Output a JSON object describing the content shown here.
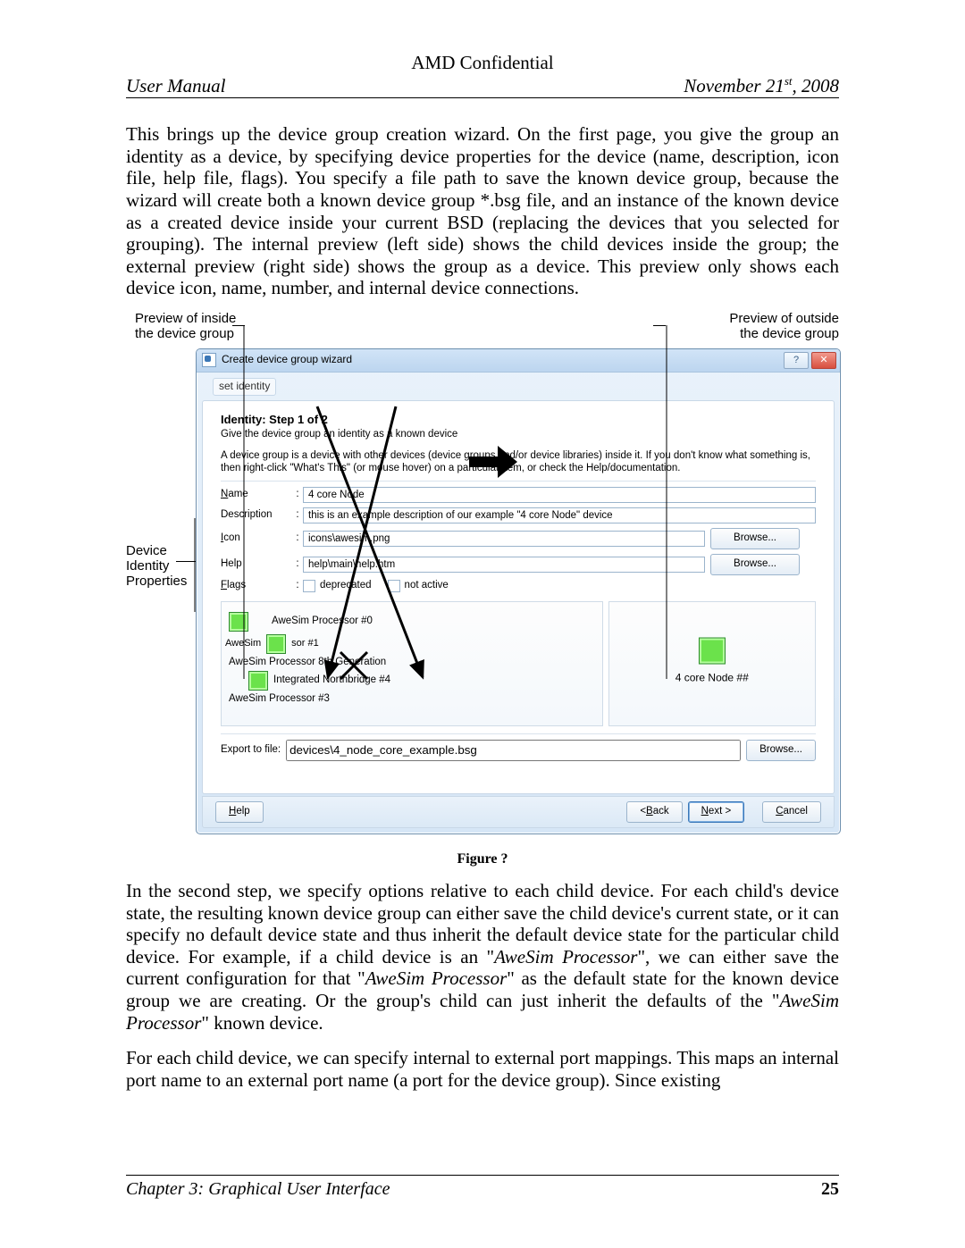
{
  "header": {
    "confidential": "AMD Confidential",
    "left": "User Manual",
    "date_prefix": "November 21",
    "date_sup": "st",
    "date_suffix": ", 2008"
  },
  "paragraphs": {
    "p1": "This brings up the device group creation wizard. On the first page, you give the group an identity as a device, by specifying device properties for the device (name, description, icon file, help file, flags). You specify a file path to save the known device group, because the wizard will create both a known device group *.bsg file, and an instance of the known device as a created device inside your current BSD (replacing the devices that you selected for grouping). The internal preview (left side) shows the child devices inside the group; the external preview (right side) shows the group as a device. This preview only shows each device icon, name, number, and internal device connections.",
    "p2_pre": "In the second step, we specify options relative to each child device. For each child's device state, the resulting known device group can either save the child device's current state, or it can specify no default device state and thus inherit the default device state for the particular child device. For example, if a child device is an \"",
    "p2_i1": "AweSim Processor",
    "p2_mid1": "\", we can either save the current configuration for that \"",
    "p2_i2": "AweSim Processor",
    "p2_mid2": "\" as the default state for the known device group we are creating. Or the group's child can just inherit the defaults of the \"",
    "p2_i3": "AweSim Processor",
    "p2_post": "\" known device.",
    "p3": "For each child device, we can specify internal to external port mappings. This maps an internal port name to an external port name (a port for the device group). Since existing"
  },
  "callouts": {
    "tl1": "Preview of inside",
    "tl2": "the device group",
    "tr1": "Preview of outside",
    "tr2": "the device group",
    "left1": "Device",
    "left2": "Identity",
    "left3": "Properties"
  },
  "wizard": {
    "title": "Create device group wizard",
    "step_indicator": "set identity",
    "heading": "Identity: Step 1 of 2",
    "subheading": "Give the device group an identity as a known device",
    "desc": "A device group is a device with other devices (device groups and/or device libraries) inside it.  If you don't know what something is, then right-click \"What's This\" (or mouse hover) on a particular item, or check the Help/documentation.",
    "labels": {
      "name": "Name",
      "description": "Description",
      "icon": "Icon",
      "help": "Help",
      "flags": "Flags",
      "deprecated": "deprecated",
      "not_active": "not active",
      "export_to_file": "Export to file:"
    },
    "values": {
      "name": "4 core Node",
      "description": "this is an example description of our example \"4 core Node\" device",
      "icon": "icons\\awesim.png",
      "help": "help\\main\\help.htm",
      "export": "devices\\4_node_core_example.bsg"
    },
    "buttons": {
      "browse": "Browse...",
      "help": "Help",
      "back": "< Back",
      "next": "Next >",
      "cancel": "Cancel"
    },
    "preview_left": {
      "n0": "AweSim Processor #0",
      "n1": "AweSim Processor #1",
      "n2": "AweSim Processor 8th Generation",
      "n2b": "Integrated Northbridge #4",
      "n3": "AweSim Processor #3"
    },
    "preview_right": {
      "label": "4 core Node ##"
    }
  },
  "figure_caption": "Figure ?",
  "footer": {
    "left": "Chapter 3: Graphical User Interface",
    "page": "25"
  }
}
